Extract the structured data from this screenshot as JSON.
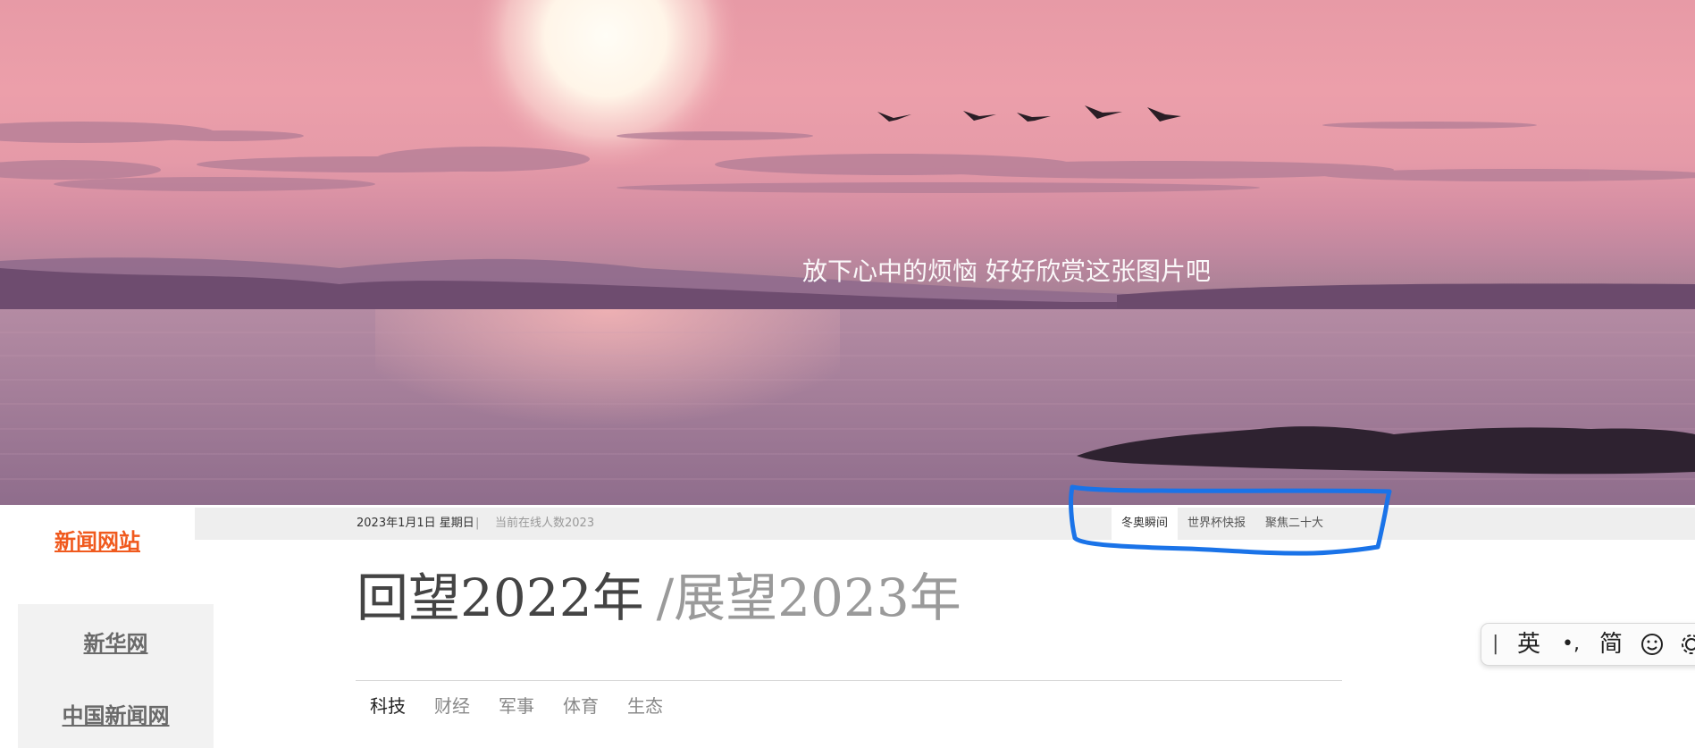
{
  "hero": {
    "caption": "放下心中的烦恼 好好欣赏这张图片吧"
  },
  "sidebar": {
    "site_title": "新闻网站",
    "links": [
      "新华网",
      "中国新闻网"
    ]
  },
  "info_bar": {
    "date": "2023年1月1日 星期日",
    "separator": "|",
    "online": "当前在线人数2023",
    "quick_tabs": [
      "冬奥瞬间",
      "世界杯快报",
      "聚焦二十大"
    ]
  },
  "headline": {
    "first": "回望2022年",
    "second": "/展望2023年"
  },
  "category_tabs": [
    "科技",
    "财经",
    "军事",
    "体育",
    "生态"
  ],
  "ime_toolbar": {
    "cursor": "|",
    "language": "英",
    "punctuation": "•,",
    "charset": "简",
    "emoji_icon": "smile-icon",
    "settings_icon": "gear-icon"
  },
  "colors": {
    "site_title": "#f05a1e",
    "annotation": "#1a73e8",
    "info_bar_bg": "#eeeeee"
  }
}
